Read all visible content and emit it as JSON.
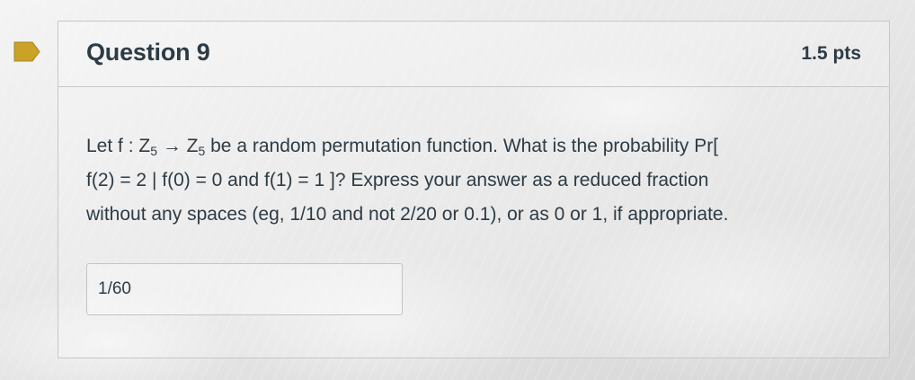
{
  "question": {
    "title": "Question 9",
    "points": "1.5 pts",
    "flag_icon": "bookmark-flag-icon",
    "flag_color": "#c9a227",
    "text": {
      "line1_pre": "Let f : Z",
      "sub1": "5",
      "arrow": " → Z",
      "sub2": "5",
      "line1_post": " be a random permutation function. What is the probability Pr[",
      "line2": "f(2) = 2 | f(0) = 0 and f(1) = 1 ]? Express your answer as a reduced fraction",
      "line3": "without any spaces (eg, 1/10 and not 2/20 or 0.1), or as 0 or 1, if appropriate."
    },
    "answer_value": "1/60"
  }
}
